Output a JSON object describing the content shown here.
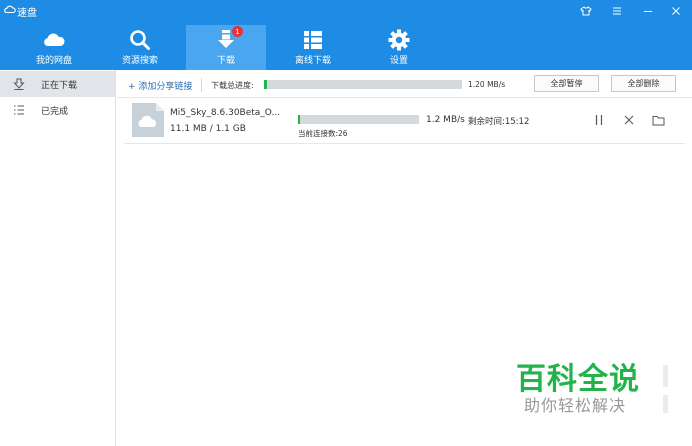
{
  "window": {
    "title": "速盘"
  },
  "nav": {
    "items": [
      {
        "label": "我的网盘",
        "icon": "cloud-icon"
      },
      {
        "label": "资源搜索",
        "icon": "search-icon"
      },
      {
        "label": "下载",
        "icon": "download-icon",
        "badge": "1",
        "active": true
      },
      {
        "label": "离线下载",
        "icon": "list-icon"
      },
      {
        "label": "设置",
        "icon": "gear-icon"
      }
    ]
  },
  "sidebar": {
    "items": [
      {
        "label": "正在下载",
        "icon": "download-outline-icon",
        "active": true
      },
      {
        "label": "已完成",
        "icon": "list-check-icon"
      }
    ]
  },
  "actions": {
    "add_link": "+ 添加分享链接",
    "total_label": "下载总进度:",
    "total_progress": 0.015,
    "total_speed": "1.20 MB/s",
    "pause_all": "全部暂停",
    "delete_all": "全部删除"
  },
  "downloads": [
    {
      "name": "Mi5_Sky_8.6.30Beta_O...",
      "size": "11.1 MB / 1.1 GB",
      "progress": 0.01,
      "speed": "1.2 MB/s",
      "remaining": "剩余时间:15:12",
      "connections": "当前连接数:26"
    }
  ],
  "watermark": {
    "title": "百科全说",
    "subtitle": "助你轻松解决"
  },
  "colors": {
    "accent": "#1e8ce5",
    "active_nav": "#4aa6ee",
    "progress": "#23b24b",
    "badge": "#e8333a",
    "watermark": "#22b34a"
  }
}
